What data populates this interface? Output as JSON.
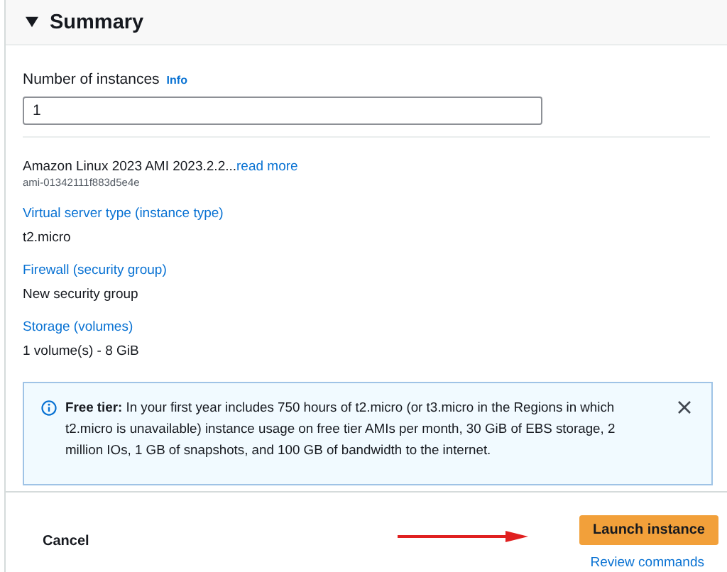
{
  "summary": {
    "title": "Summary",
    "expanded": true
  },
  "instances": {
    "label": "Number of instances",
    "info_link": "Info",
    "value": "1"
  },
  "ami": {
    "name": "Amazon Linux 2023 AMI 2023.2.2...",
    "read_more": "read more",
    "id": "ami-01342111f883d5e4e"
  },
  "details": [
    {
      "label": "Virtual server type (instance type)",
      "value": "t2.micro"
    },
    {
      "label": "Firewall (security group)",
      "value": "New security group"
    },
    {
      "label": "Storage (volumes)",
      "value": "1 volume(s) - 8 GiB"
    }
  ],
  "free_tier": {
    "text": "**Free tier:** In your first year includes 750 hours of t2.micro (or t3.micro in the Regions in which t2.micro is unavailable) instance usage on free tier AMIs per month, 30 GiB of EBS storage, 2 million IOs, 1 GB of snapshots, and 100 GB of bandwidth to the internet."
  },
  "footer": {
    "cancel": "Cancel",
    "launch": "Launch instance",
    "review": "Review commands"
  }
}
